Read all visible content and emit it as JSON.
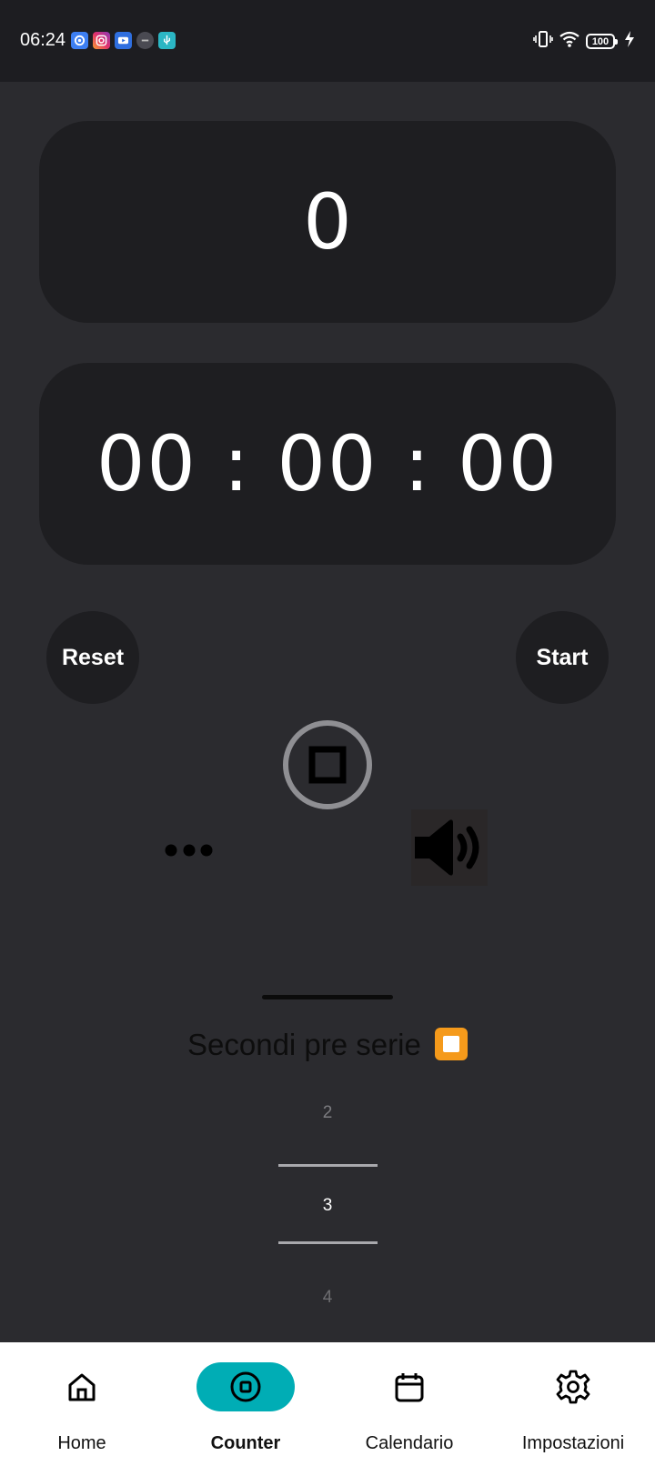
{
  "status_bar": {
    "time": "06:24",
    "battery": "100",
    "notification_icons": [
      "settings-app-icon",
      "instagram-icon",
      "youtube-icon",
      "app-icon",
      "usb-icon"
    ],
    "system_icons": [
      "vibrate-icon",
      "wifi-icon",
      "battery-icon",
      "charging-icon"
    ]
  },
  "counter": {
    "value": "0"
  },
  "timer": {
    "value": "00 : 00 : 00"
  },
  "controls": {
    "reset_label": "Reset",
    "start_label": "Start",
    "icons": [
      "stop-icon",
      "more-icon",
      "volume-icon"
    ]
  },
  "sheet": {
    "title": "Secondi pre serie"
  },
  "picker": {
    "prev": "2",
    "selected": "3",
    "next": "4"
  },
  "nav": {
    "items": [
      {
        "label": "Home",
        "icon": "home-icon"
      },
      {
        "label": "Counter",
        "icon": "counter-icon"
      },
      {
        "label": "Calendario",
        "icon": "calendar-icon"
      },
      {
        "label": "Impostazioni",
        "icon": "settings-icon"
      }
    ],
    "active": "Counter"
  },
  "colors": {
    "background": "#2b2b2f",
    "card": "#1e1e21",
    "accent": "#00adb5",
    "title_icon": "#f59a1b"
  }
}
